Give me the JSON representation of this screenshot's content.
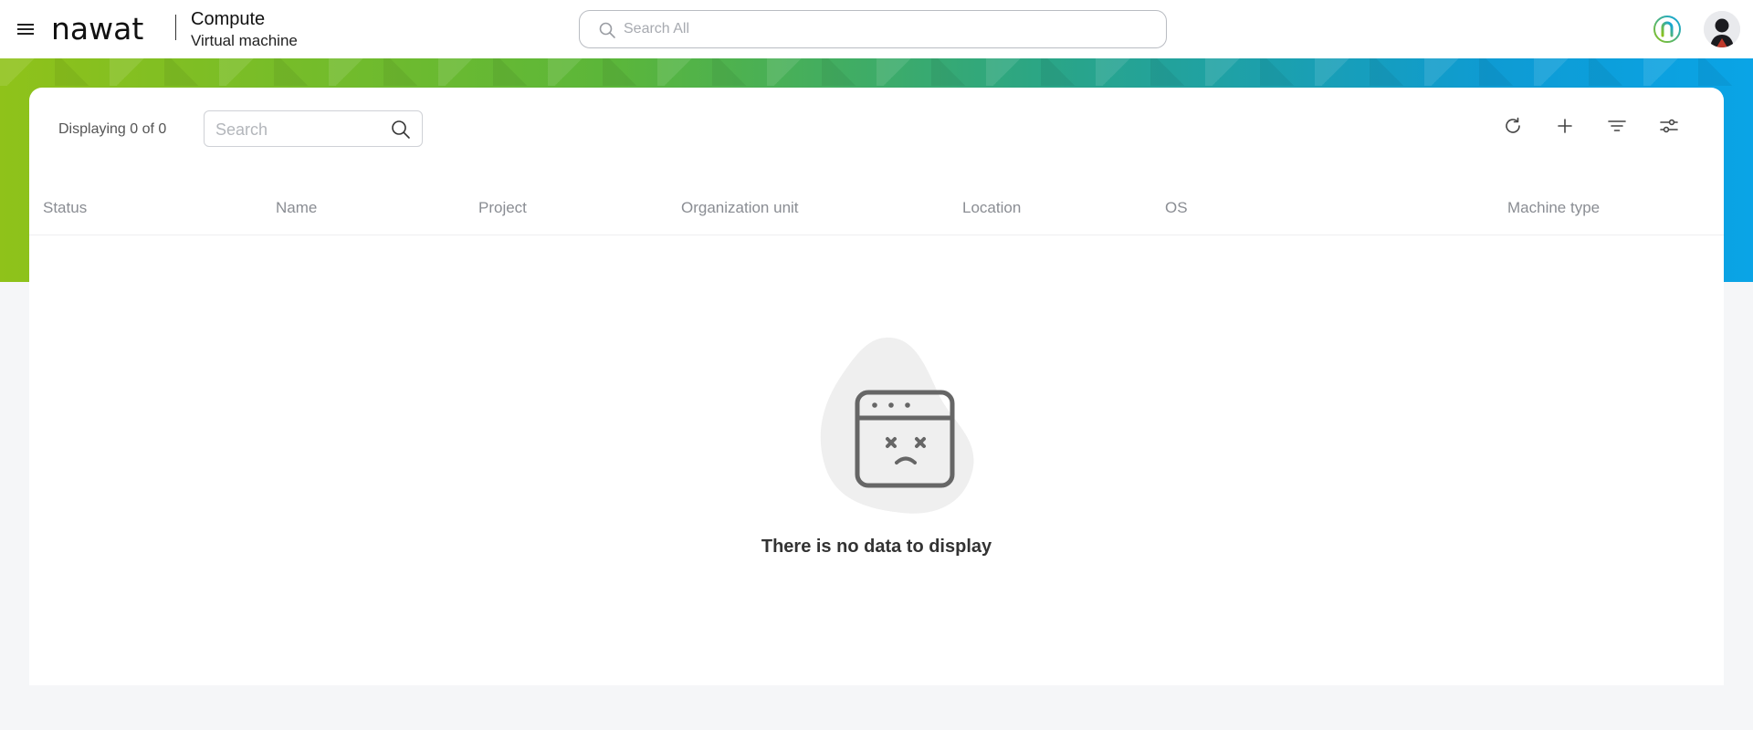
{
  "header": {
    "logo_text": "nawat",
    "app_title": "Compute",
    "app_subtitle": "Virtual machine",
    "search_placeholder": "Search All"
  },
  "toolbar": {
    "display_count": "Displaying 0 of 0",
    "search_placeholder": "Search"
  },
  "table": {
    "columns": [
      "Status",
      "Name",
      "Project",
      "Organization unit",
      "Location",
      "OS",
      "Machine type"
    ]
  },
  "empty_state": {
    "message": "There is no data to display"
  },
  "colors": {
    "banner_start": "#8fc21a",
    "banner_end": "#0aa4e6",
    "card_bg": "#ffffff",
    "page_bg": "#f5f6f8"
  },
  "icons": {
    "menu": "hamburger-menu-icon",
    "search": "search-icon",
    "refresh": "refresh-icon",
    "add": "plus-icon",
    "filter": "filter-icon",
    "settings": "sliders-icon",
    "brand": "brand-badge-icon",
    "avatar": "user-avatar",
    "empty": "empty-window-sad-icon"
  }
}
